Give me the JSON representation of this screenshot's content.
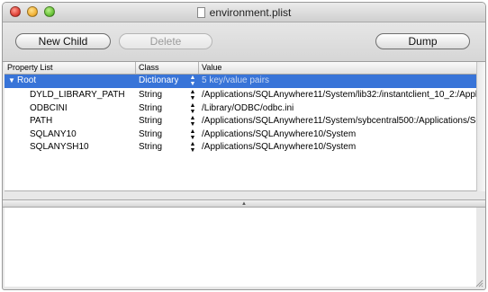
{
  "window": {
    "title": "environment.plist"
  },
  "toolbar": {
    "new_child_label": "New Child",
    "delete_label": "Delete",
    "dump_label": "Dump"
  },
  "columns": {
    "property_list": "Property List",
    "class": "Class",
    "value": "Value"
  },
  "rows": [
    {
      "name": "Root",
      "class": "Dictionary",
      "value": "5 key/value pairs",
      "selected": true
    },
    {
      "name": "DYLD_LIBRARY_PATH",
      "class": "String",
      "value": "/Applications/SQLAnywhere11/System/lib32:/instantclient_10_2:/Appli"
    },
    {
      "name": "ODBCINI",
      "class": "String",
      "value": "/Library/ODBC/odbc.ini"
    },
    {
      "name": "PATH",
      "class": "String",
      "value": "/Applications/SQLAnywhere11/System/sybcentral500:/Applications/SC"
    },
    {
      "name": "SQLANY10",
      "class": "String",
      "value": "/Applications/SQLAnywhere10/System"
    },
    {
      "name": "SQLANYSH10",
      "class": "String",
      "value": "/Applications/SQLAnywhere10/System"
    }
  ],
  "colors": {
    "selection": "#3874d8",
    "selected_value_text": "#c9d8f2"
  }
}
